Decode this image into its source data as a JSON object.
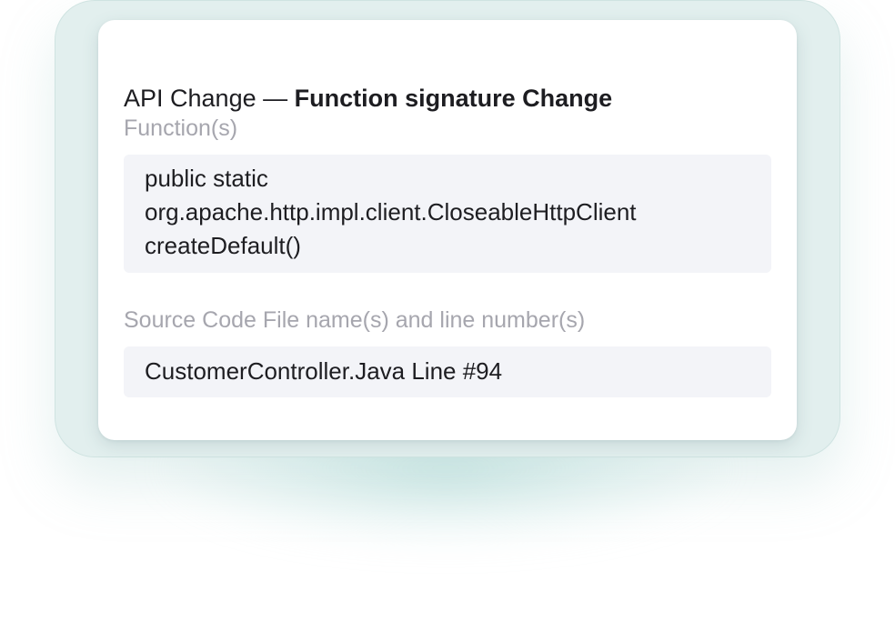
{
  "card": {
    "heading_prefix": "API Change — ",
    "heading_emphasis": "Function signature Change",
    "functions_label": "Function(s)",
    "functions_lines": [
      "public static",
      "org.apache.http.impl.client.CloseableHttpClient",
      "createDefault()"
    ],
    "source_label": "Source Code File name(s) and line number(s)",
    "source_value": "CustomerController.Java Line #94"
  },
  "colors": {
    "frame": "#e2efee",
    "card": "#ffffff",
    "value_box": "#f3f4f8",
    "label_text": "#a6a6ae",
    "body_text": "#1d1d21"
  }
}
